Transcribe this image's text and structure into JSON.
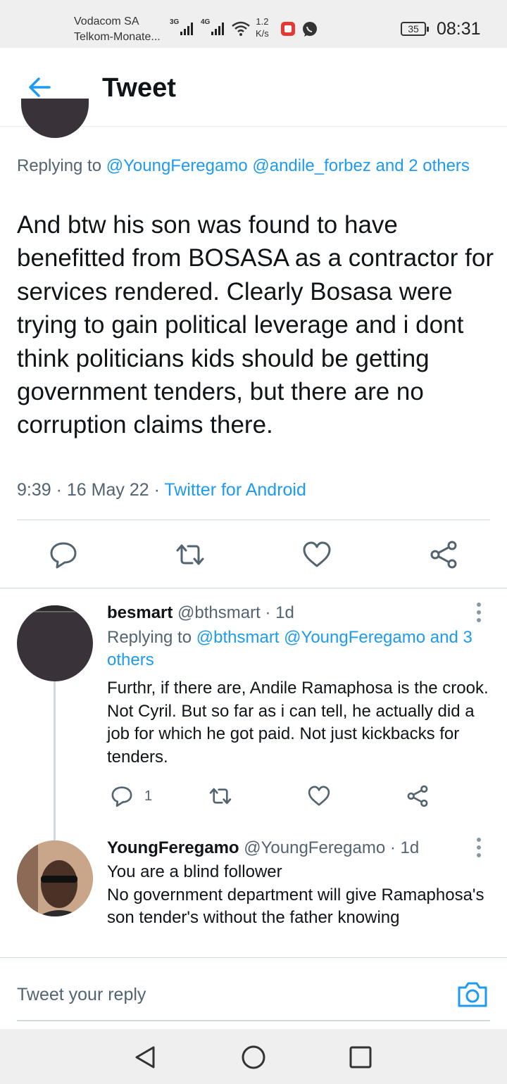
{
  "status_bar": {
    "carrier_1": "Vodacom SA",
    "carrier_2": "Telkom-Monate...",
    "sig_1": "3G",
    "sig_2": "4G",
    "speed_value": "1.2",
    "speed_unit": "K/s",
    "battery": "35",
    "time": "08:31"
  },
  "header": {
    "title": "Tweet"
  },
  "main_tweet": {
    "replying_prefix": "Replying to ",
    "replying_users": "@YoungFeregamo @andile_forbez",
    "replying_suffix": " and 2 others",
    "text": "And btw his son was found to have benefitted from BOSASA as a contractor for services rendered. Clearly Bosasa were trying to gain political leverage and i dont think politicians kids should be getting government tenders, but there are no corruption claims there.",
    "time": "9:39",
    "sep1": " · ",
    "date": "16 May 22",
    "sep2": " · ",
    "source": "Twitter for Android"
  },
  "replies": [
    {
      "name": "besmart",
      "handle": "@bthsmart",
      "dot": " · ",
      "age": "1d",
      "replying_prefix": "Replying to ",
      "replying_users": "@bthsmart @YoungFeregamo",
      "replying_suffix": " and 3 others",
      "text": "Furthr, if there are, Andile Ramaphosa is the crook. Not Cyril. But so far as i can tell, he actually did a job for which he got paid. Not just kickbacks for tenders.",
      "reply_count": "1"
    },
    {
      "name": "YoungFeregamo",
      "handle": "@YoungFeregamo",
      "dot": " · ",
      "age": "1d",
      "text_line1": "You are a blind follower",
      "text_line2": "No government department will give Ramaphosa's son tender's without the father knowing"
    }
  ],
  "reply_bar": {
    "placeholder": "Tweet your reply"
  },
  "colors": {
    "accent": "#1d9bf0",
    "text": "#0f1419",
    "muted": "#536471",
    "divider": "#cfd9de"
  },
  "icons": [
    "back-arrow-icon",
    "reply-icon",
    "retweet-icon",
    "like-icon",
    "share-icon",
    "more-icon",
    "camera-icon",
    "nav-back-icon",
    "nav-home-icon",
    "nav-recents-icon"
  ]
}
